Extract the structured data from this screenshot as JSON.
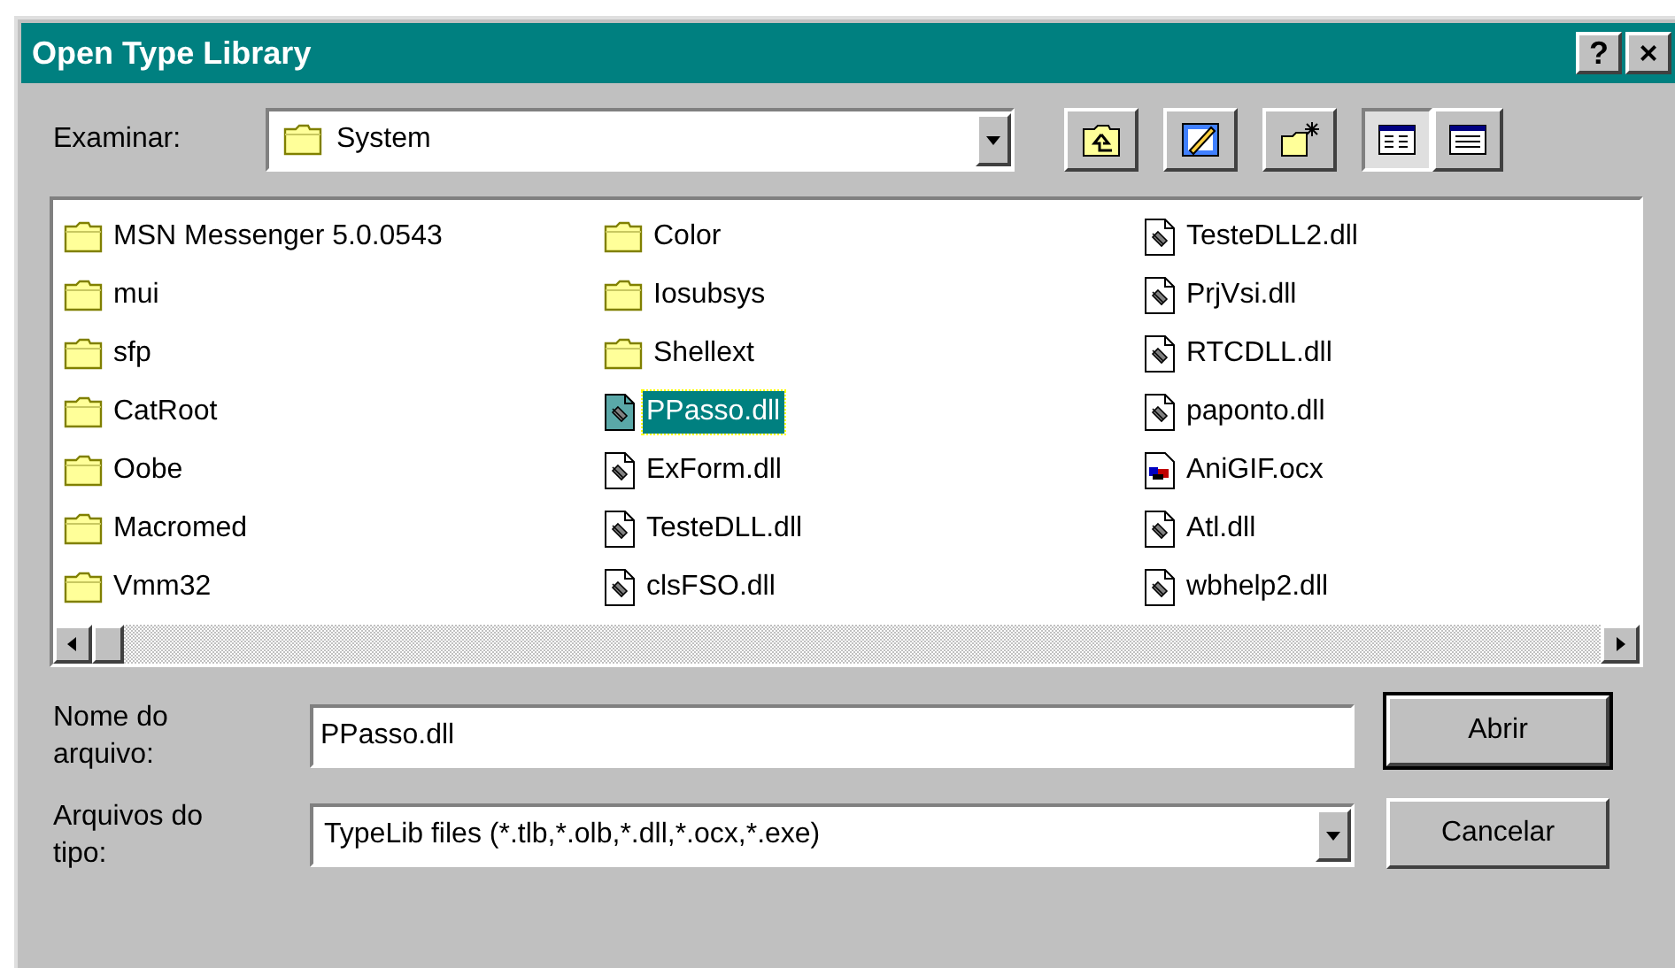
{
  "window": {
    "title": "Open Type Library",
    "buttons": [
      "?",
      "×"
    ]
  },
  "look_in": {
    "label": "Examinar:",
    "value": "System"
  },
  "files": [
    {
      "name": "MSN Messenger 5.0.0543",
      "kind": "folder",
      "selected": false
    },
    {
      "name": "mui",
      "kind": "folder",
      "selected": false
    },
    {
      "name": "sfp",
      "kind": "folder",
      "selected": false
    },
    {
      "name": "CatRoot",
      "kind": "folder",
      "selected": false
    },
    {
      "name": "Oobe",
      "kind": "folder",
      "selected": false
    },
    {
      "name": "Macromed",
      "kind": "folder",
      "selected": false
    },
    {
      "name": "Vmm32",
      "kind": "folder",
      "selected": false
    },
    {
      "name": "Color",
      "kind": "folder",
      "selected": false
    },
    {
      "name": "Iosubsys",
      "kind": "folder",
      "selected": false
    },
    {
      "name": "Shellext",
      "kind": "folder",
      "selected": false
    },
    {
      "name": "PPasso.dll",
      "kind": "dll",
      "selected": true
    },
    {
      "name": "ExForm.dll",
      "kind": "dll",
      "selected": false
    },
    {
      "name": "TesteDLL.dll",
      "kind": "dll",
      "selected": false
    },
    {
      "name": "clsFSO.dll",
      "kind": "dll",
      "selected": false
    },
    {
      "name": "TesteDLL2.dll",
      "kind": "dll",
      "selected": false
    },
    {
      "name": "PrjVsi.dll",
      "kind": "dll",
      "selected": false
    },
    {
      "name": "RTCDLL.dll",
      "kind": "dll",
      "selected": false
    },
    {
      "name": "paponto.dll",
      "kind": "dll",
      "selected": false
    },
    {
      "name": "AniGIF.ocx",
      "kind": "ocx",
      "selected": false
    },
    {
      "name": "Atl.dll",
      "kind": "dll",
      "selected": false
    },
    {
      "name": "wbhelp2.dll",
      "kind": "dll",
      "selected": false
    }
  ],
  "file_name": {
    "label": "Nome do arquivo:",
    "value": "PPasso.dll"
  },
  "file_type": {
    "label": "Arquivos do tipo:",
    "value": "TypeLib files (*.tlb,*.olb,*.dll,*.ocx,*.exe)"
  },
  "buttons": [
    {
      "label": "Abrir",
      "default": true
    },
    {
      "label": "Cancelar",
      "default": false
    }
  ]
}
